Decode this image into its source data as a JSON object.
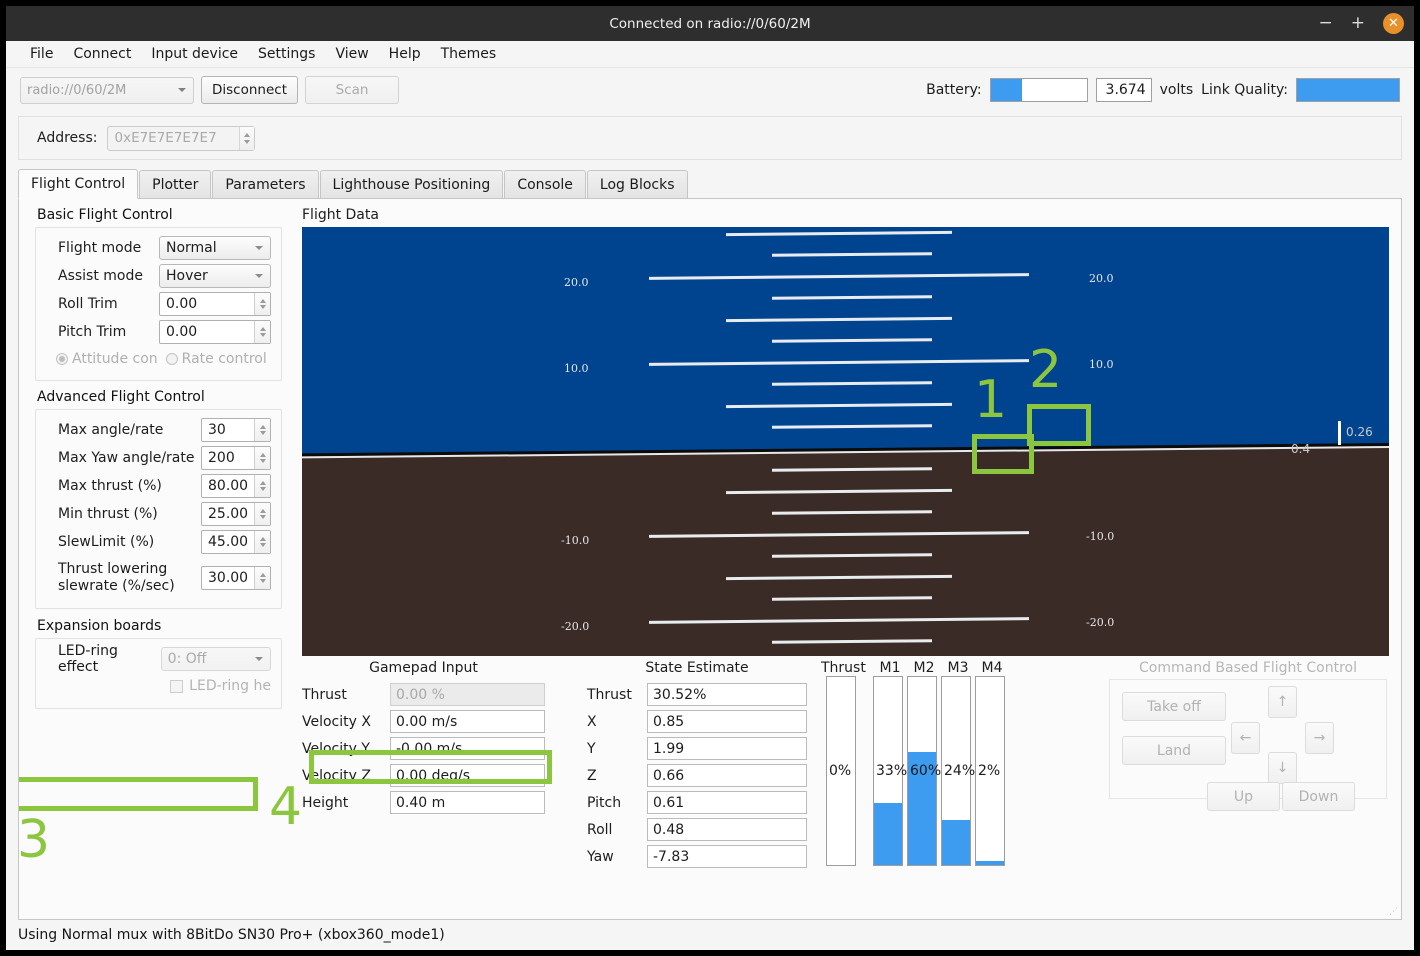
{
  "window": {
    "title": "Connected on radio://0/60/2M",
    "minimize_label": "−",
    "maximize_label": "+",
    "close_label": "✕",
    "close_color": "#e8912b"
  },
  "menubar": {
    "items": [
      "File",
      "Connect",
      "Input device",
      "Settings",
      "View",
      "Help",
      "Themes"
    ]
  },
  "toolbar": {
    "uri_value": "radio://0/60/2M",
    "disconnect_label": "Disconnect",
    "scan_label": "Scan",
    "battery_label": "Battery:",
    "battery_percent": 33,
    "battery_volts": "3.674",
    "volts_label": "volts",
    "link_quality_label": "Link Quality:",
    "link_quality_percent": 100,
    "accent_color": "#3d9bf0"
  },
  "address": {
    "label": "Address:",
    "value": "0xE7E7E7E7E7"
  },
  "tabs": [
    {
      "label": "Flight Control",
      "active": true
    },
    {
      "label": "Plotter",
      "active": false
    },
    {
      "label": "Parameters",
      "active": false
    },
    {
      "label": "Lighthouse Positioning",
      "active": false
    },
    {
      "label": "Console",
      "active": false
    },
    {
      "label": "Log Blocks",
      "active": false
    }
  ],
  "basic_flight_control": {
    "title": "Basic Flight Control",
    "flight_mode_label": "Flight mode",
    "flight_mode_value": "Normal",
    "assist_mode_label": "Assist mode",
    "assist_mode_value": "Hover",
    "roll_trim_label": "Roll Trim",
    "roll_trim_value": "0.00",
    "pitch_trim_label": "Pitch Trim",
    "pitch_trim_value": "0.00",
    "attitude_control_label": "Attitude con",
    "rate_control_label": "Rate control"
  },
  "advanced_flight_control": {
    "title": "Advanced Flight Control",
    "rows": [
      {
        "label": "Max angle/rate",
        "value": "30"
      },
      {
        "label": "Max Yaw angle/rate",
        "value": "200"
      },
      {
        "label": "Max thrust (%)",
        "value": "80.00"
      },
      {
        "label": "Min thrust (%)",
        "value": "25.00"
      },
      {
        "label": "SlewLimit (%)",
        "value": "45.00"
      },
      {
        "label": "Thrust lowering slewrate (%/sec)",
        "value": "30.00"
      }
    ]
  },
  "expansion_boards": {
    "title": "Expansion boards",
    "led_ring_effect_label": "LED-ring effect",
    "led_ring_effect_value": "0: Off",
    "led_ring_headlight_label": "LED-ring he"
  },
  "flight_data": {
    "title": "Flight Data",
    "sky_color": "#00448f",
    "ground_color": "#3b2b26",
    "pitch_ticks_left": [
      "20.0",
      "10.0",
      "-10.0",
      "-20.0"
    ],
    "pitch_ticks_right": [
      "20.0",
      "10.0",
      "-10.0",
      "-20.0"
    ],
    "altitude_value": "0.4",
    "vertical_speed_value": "0.26"
  },
  "gamepad_input": {
    "title": "Gamepad Input",
    "rows": [
      {
        "label": "Thrust",
        "value": "0.00 %",
        "disabled": true
      },
      {
        "label": "Velocity X",
        "value": "0.00 m/s",
        "disabled": false
      },
      {
        "label": "Velocity Y",
        "value": "-0.00 m/s",
        "disabled": false
      },
      {
        "label": "Velocity Z",
        "value": "0.00 deg/s",
        "disabled": false
      },
      {
        "label": "Height",
        "value": "0.40 m",
        "disabled": false
      }
    ]
  },
  "state_estimate": {
    "title": "State Estimate",
    "rows": [
      {
        "label": "Thrust",
        "value": "30.52%"
      },
      {
        "label": "X",
        "value": "0.85"
      },
      {
        "label": "Y",
        "value": "1.99"
      },
      {
        "label": "Z",
        "value": "0.66"
      },
      {
        "label": "Pitch",
        "value": "0.61"
      },
      {
        "label": "Roll",
        "value": "0.48"
      },
      {
        "label": "Yaw",
        "value": "-7.83"
      }
    ]
  },
  "motors": {
    "bars": [
      {
        "name": "Thrust",
        "text": "0%",
        "percent": 0
      },
      {
        "name": "M1",
        "text": "33%",
        "percent": 33
      },
      {
        "name": "M2",
        "text": "60%",
        "percent": 60
      },
      {
        "name": "M3",
        "text": "24%",
        "percent": 24
      },
      {
        "name": "M4",
        "text": "2%",
        "percent": 2
      }
    ],
    "fill_color": "#3d9bf0"
  },
  "command_flight_control": {
    "title": "Command Based Flight Control",
    "takeoff_label": "Take off",
    "land_label": "Land",
    "up_arrow": "↑",
    "down_arrow": "↓",
    "left_arrow": "←",
    "right_arrow": "→",
    "up_label": "Up",
    "down_label": "Down"
  },
  "statusbar": {
    "text": "Using Normal mux with 8BitDo SN30 Pro+ (xbox360_mode1)"
  },
  "annotations": {
    "color": "#8cc63f",
    "items": [
      {
        "num": "1",
        "target": "altitude-readout"
      },
      {
        "num": "2",
        "target": "vertical-speed-readout"
      },
      {
        "num": "3",
        "target": "height-field"
      },
      {
        "num": "4",
        "target": "state-estimate-z-field"
      }
    ]
  }
}
